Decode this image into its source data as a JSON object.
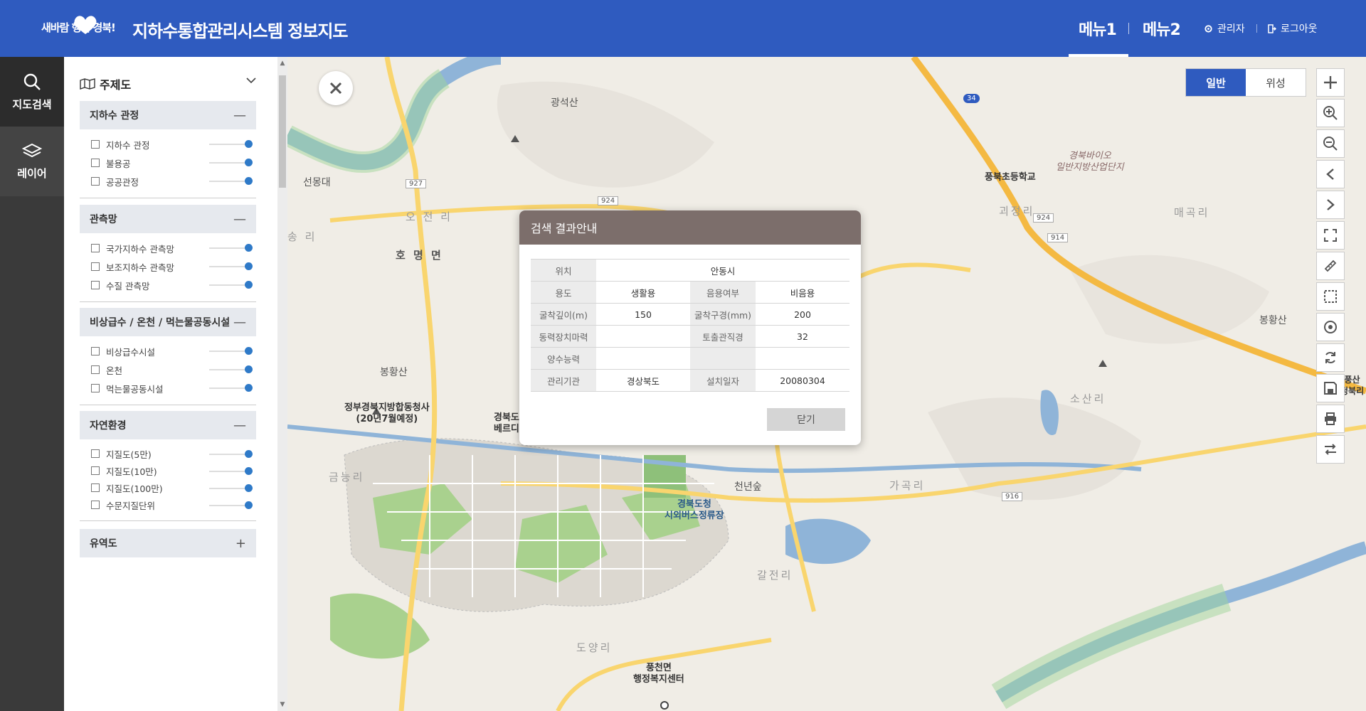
{
  "header": {
    "logo_text": "새바람 행복 경북!",
    "title": "지하수통합관리시스템 정보지도",
    "menu1": "메뉴1",
    "menu2": "메뉴2",
    "admin": "관리자",
    "logout": "로그아웃",
    "color": "#2f5bbf"
  },
  "leftnav": {
    "search": "지도검색",
    "layer": "레이어"
  },
  "panel": {
    "title": "주제도",
    "sections": [
      {
        "title": "지하수 관정",
        "toggle": "—",
        "items": [
          "지하수 관정",
          "불용공",
          "공공관정"
        ]
      },
      {
        "title": "관측망",
        "toggle": "—",
        "items": [
          "국가지하수 관측망",
          "보조지하수 관측망",
          "수질 관측망"
        ]
      },
      {
        "title": "비상급수 / 온천 / 먹는물공동시설",
        "toggle": "—",
        "items": [
          "비상급수시설",
          "온천",
          "먹는물공동시설"
        ]
      },
      {
        "title": "자연환경",
        "toggle": "—",
        "items": [
          "지질도(5만)",
          "지질도(10만)",
          "지질도(100만)",
          "수문지질단위"
        ]
      },
      {
        "title": "유역도",
        "toggle": "+",
        "items": []
      }
    ],
    "slider_opacity": 1.0
  },
  "map": {
    "basemap_normal": "일반",
    "basemap_satellite": "위성",
    "labels": {
      "gwangseoksan": "광석산",
      "seonmongdae": "선몽대",
      "hwamyeonmyeon": "호 명 면",
      "songni": "송 리",
      "ojeonni": "오 전 리",
      "bonghwangsan1": "봉황산",
      "govt": "정부경북지방합동청사\n(20년7월예정)",
      "geumneungni": "금능리",
      "pungbuk_school": "풍북초등학교",
      "industrial": "경북바이오\n일반지방산업단지",
      "goejeongni": "괴정리",
      "maegokni": "매곡리",
      "bonghwangsan2": "봉황산",
      "sosanni": "소산리",
      "gagokni": "가곡리",
      "cheonnyeonsup": "천년숲",
      "bus_terminal": "경북도청\n시외버스정류장",
      "gapjeonni": "갈전리",
      "doyangni": "도양리",
      "pungcheon": "풍천면\n행정복지센터",
      "gyeongbuk_office": "경북도\n베르디",
      "pungsan": "풍산\n정북리",
      "route34": "34",
      "route927": "927",
      "route924a": "924",
      "route924b": "924",
      "route914": "914",
      "route916": "916"
    }
  },
  "dialog": {
    "title": "검색 결과안내",
    "rows": [
      {
        "h1": "위치",
        "v1": "안동시"
      },
      {
        "h1": "용도",
        "v1": "생활용",
        "h2": "음용여부",
        "v2": "비음용"
      },
      {
        "h1": "굴착깊이(m)",
        "v1": "150",
        "h2": "굴착구경(mm)",
        "v2": "200"
      },
      {
        "h1": "동력장치마력",
        "v1": "",
        "h2": "토출관직경",
        "v2": "32"
      },
      {
        "h1": "양수능력",
        "v1": "",
        "h2": "",
        "v2": ""
      },
      {
        "h1": "관리기관",
        "v1": "경상북도",
        "h2": "설치일자",
        "v2": "20080304"
      }
    ],
    "close_label": "닫기"
  }
}
